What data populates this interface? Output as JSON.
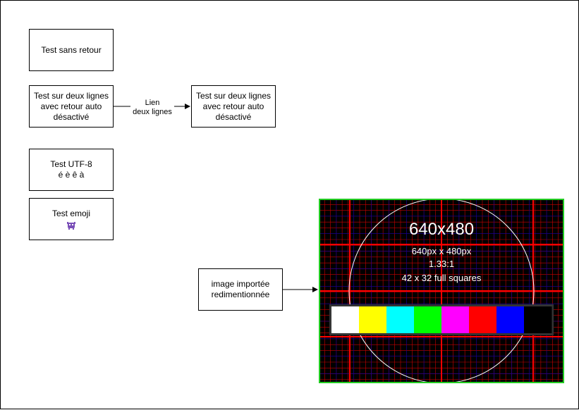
{
  "nodes": {
    "sans_retour": "Test sans retour",
    "deux_lignes_left": "Test sur deux lignes\navec retour auto\ndésactivé",
    "deux_lignes_right": "Test sur deux lignes\navec retour auto\ndésactivé",
    "utf8": "Test UTF-8\né è ê à",
    "emoji": "Test emoji",
    "emoji_icon": "alien-monster-icon",
    "image_importee": "image importée\nredimentionnée"
  },
  "edges": {
    "lien_label": "Lien\ndeux lignes"
  },
  "testcard": {
    "title": "640x480",
    "line1": "640px x 480px",
    "line2": "1.33:1",
    "line3": "42 x 32 full squares",
    "frame_color": "#22cc22",
    "bars": [
      "#ffffff",
      "#ffff00",
      "#00ffff",
      "#00ff00",
      "#ff00ff",
      "#ff0000",
      "#0000ff",
      "#000000"
    ]
  }
}
